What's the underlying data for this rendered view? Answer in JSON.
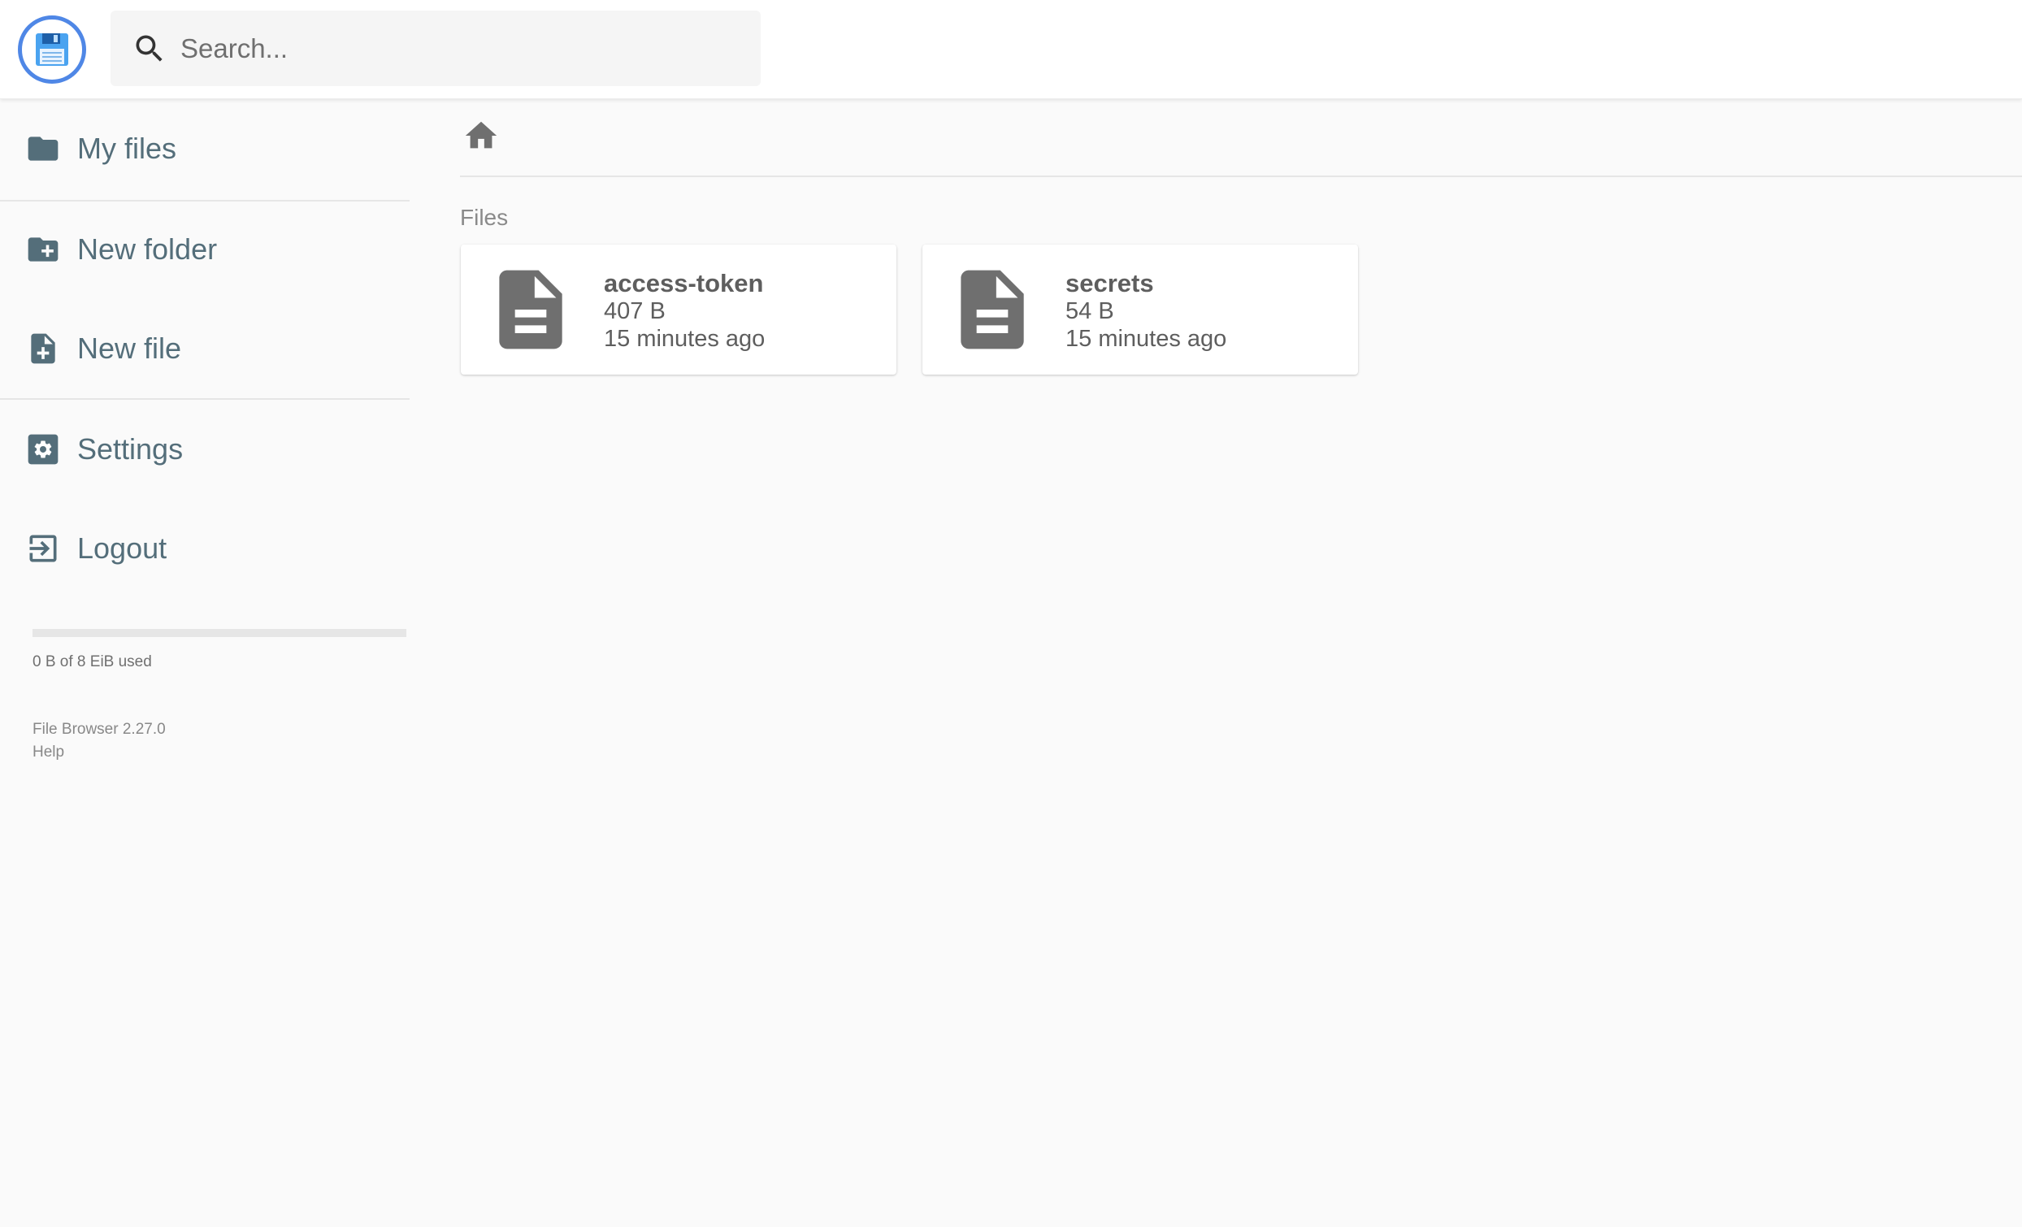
{
  "header": {
    "logo_icon": "floppy-disk-icon",
    "search_placeholder": "Search...",
    "search_icon": "search-icon"
  },
  "sidebar": {
    "items": [
      {
        "label": "My files",
        "icon": "folder-icon"
      },
      {
        "label": "New folder",
        "icon": "create-new-folder-icon"
      },
      {
        "label": "New file",
        "icon": "note-add-icon"
      },
      {
        "label": "Settings",
        "icon": "settings-icon"
      },
      {
        "label": "Logout",
        "icon": "exit-icon"
      }
    ],
    "quota": {
      "text": "0 B of 8 EiB used",
      "fraction": 0
    },
    "version": "File Browser 2.27.0",
    "help": "Help"
  },
  "main": {
    "breadcrumb_icon": "home-icon",
    "section_title": "Files",
    "files": [
      {
        "name": "access-token",
        "size": "407 B",
        "modified": "15 minutes ago",
        "icon": "file-icon"
      },
      {
        "name": "secrets",
        "size": "54 B",
        "modified": "15 minutes ago",
        "icon": "file-icon"
      }
    ]
  },
  "colors": {
    "accent": "#4f87e6",
    "sidebar_text": "#546e7a",
    "file_icon": "#6f6f6f",
    "background": "#fafafa"
  }
}
